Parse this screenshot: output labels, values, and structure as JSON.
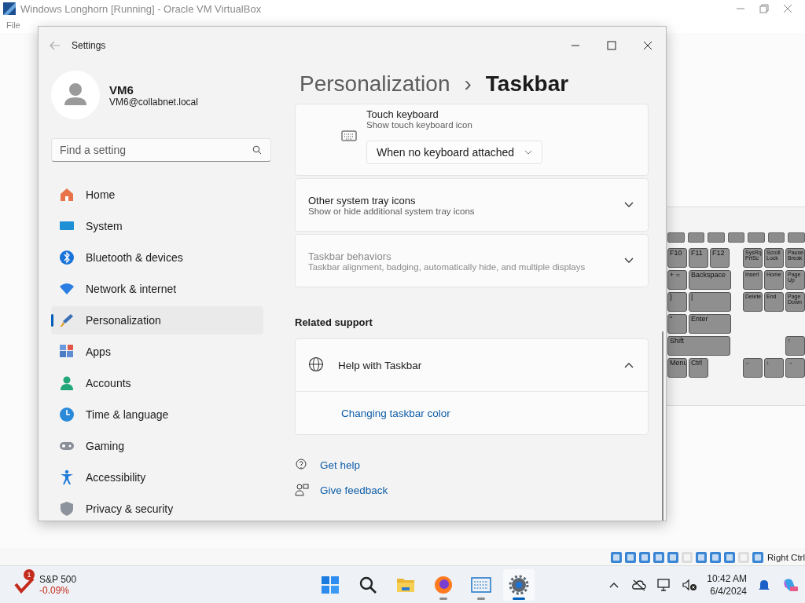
{
  "host_window": {
    "title": "Windows Longhorn [Running] - Oracle VM VirtualBox",
    "menu": [
      "File"
    ]
  },
  "settings": {
    "title": "Settings",
    "user": {
      "name": "VM6",
      "email": "VM6@collabnet.local"
    },
    "search": {
      "placeholder": "Find a setting"
    },
    "nav": [
      {
        "label": "Home",
        "selected": false
      },
      {
        "label": "System",
        "selected": false
      },
      {
        "label": "Bluetooth & devices",
        "selected": false
      },
      {
        "label": "Network & internet",
        "selected": false
      },
      {
        "label": "Personalization",
        "selected": true
      },
      {
        "label": "Apps",
        "selected": false
      },
      {
        "label": "Accounts",
        "selected": false
      },
      {
        "label": "Time & language",
        "selected": false
      },
      {
        "label": "Gaming",
        "selected": false
      },
      {
        "label": "Accessibility",
        "selected": false
      },
      {
        "label": "Privacy & security",
        "selected": false
      }
    ],
    "breadcrumb": {
      "parent": "Personalization",
      "separator": "›",
      "current": "Taskbar"
    },
    "touch_keyboard": {
      "title": "Touch keyboard",
      "description": "Show touch keyboard icon",
      "dropdown": "When no keyboard attached"
    },
    "cards": [
      {
        "title": "Other system tray icons",
        "description": "Show or hide additional system tray icons",
        "expanded": false,
        "disabled": false
      },
      {
        "title": "Taskbar behaviors",
        "description": "Taskbar alignment, badging, automatically hide, and multiple displays",
        "expanded": false,
        "disabled": true
      }
    ],
    "related_support": {
      "heading": "Related support",
      "title": "Help with Taskbar",
      "expanded": true,
      "links": [
        "Changing taskbar color"
      ]
    },
    "footer_links": [
      "Get help",
      "Give feedback"
    ]
  },
  "osk": {
    "rows": [
      {
        "left": [
          {
            "label": "F10",
            "kind": "key"
          },
          {
            "label": "F11",
            "kind": "key"
          },
          {
            "label": "F12",
            "kind": "key"
          }
        ],
        "right": [
          {
            "label": "SysRq PrtSc",
            "kind": "small"
          },
          {
            "label": "Scroll Lock",
            "kind": "small"
          },
          {
            "label": "Pause Break",
            "kind": "small"
          }
        ]
      },
      {
        "left": [
          {
            "label": "+ =",
            "kind": "key"
          },
          {
            "label": "Backspace",
            "kind": "wide"
          }
        ],
        "right": [
          {
            "label": "Insert",
            "kind": "small"
          },
          {
            "label": "Home",
            "kind": "small"
          },
          {
            "label": "Page Up",
            "kind": "small"
          }
        ]
      },
      {
        "left": [
          {
            "label": "}",
            "kind": "key"
          },
          {
            "label": "|",
            "kind": "wide"
          }
        ],
        "right": [
          {
            "label": "Delete",
            "kind": "small"
          },
          {
            "label": "End",
            "kind": "small"
          },
          {
            "label": "Page Down",
            "kind": "small"
          }
        ]
      },
      {
        "left": [
          {
            "label": "\"",
            "kind": "key"
          },
          {
            "label": "Enter",
            "kind": "wide"
          }
        ],
        "right": []
      },
      {
        "left": [
          {
            "label": "Shift",
            "kind": "wider"
          }
        ],
        "right": [
          {
            "label": "↑",
            "kind": "small"
          }
        ]
      },
      {
        "left": [
          {
            "label": "Menu",
            "kind": "key"
          },
          {
            "label": "Ctrl",
            "kind": "key"
          }
        ],
        "right": [
          {
            "label": "←",
            "kind": "small"
          },
          {
            "label": "↓",
            "kind": "small"
          },
          {
            "label": "→",
            "kind": "small"
          }
        ]
      }
    ]
  },
  "vbox_status": {
    "host_key": "Right Ctrl"
  },
  "taskbar": {
    "widget": {
      "title": "S&P 500",
      "change": "-0.09%",
      "badge": "1"
    },
    "apps": [
      {
        "selected": false,
        "running": false
      },
      {
        "selected": false,
        "running": false
      },
      {
        "selected": false,
        "running": false
      },
      {
        "selected": false,
        "running": true
      },
      {
        "selected": false,
        "running": true
      },
      {
        "selected": true,
        "running": true
      }
    ],
    "time": "10:42 AM",
    "date": "6/4/2024"
  }
}
